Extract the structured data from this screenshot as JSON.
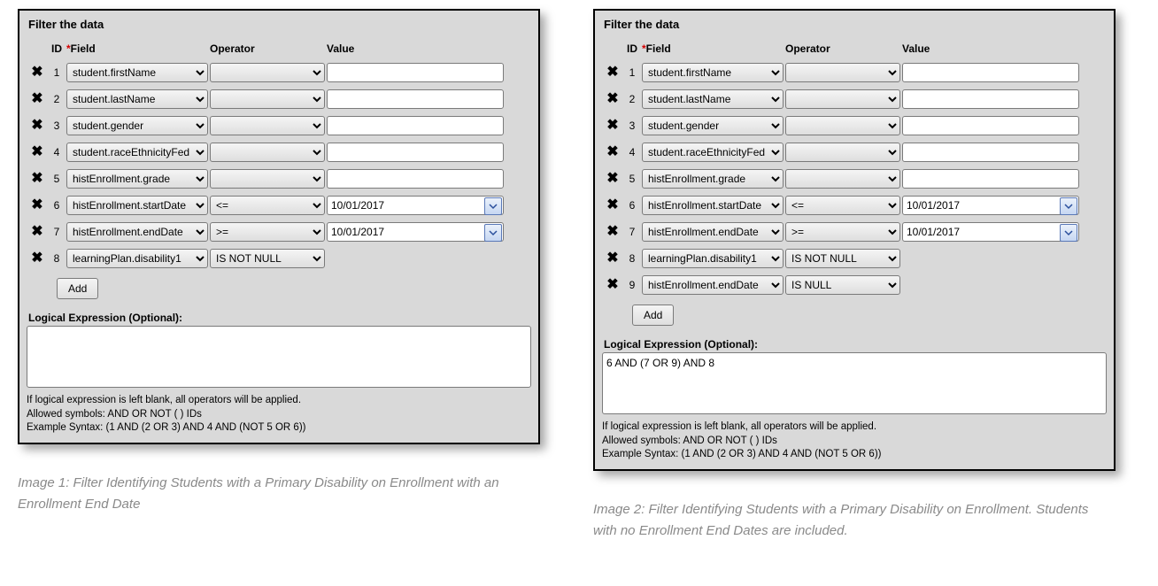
{
  "shared": {
    "panelTitle": "Filter the data",
    "headers": {
      "id": "ID",
      "fieldAsterisk": "*",
      "field": "Field",
      "operator": "Operator",
      "value": "Value"
    },
    "addLabel": "Add",
    "lexLabel": "Logical Expression (Optional):",
    "help1": "If logical expression is left blank, all operators will be applied.",
    "help2": "Allowed symbols: AND OR NOT ( ) IDs",
    "help3": "Example Syntax: (1 AND (2 OR 3) AND 4 AND (NOT 5 OR 6))"
  },
  "panels": [
    {
      "rows": [
        {
          "id": "1",
          "field": "student.firstName",
          "op": "",
          "value": "",
          "date": false
        },
        {
          "id": "2",
          "field": "student.lastName",
          "op": "",
          "value": "",
          "date": false
        },
        {
          "id": "3",
          "field": "student.gender",
          "op": "",
          "value": "",
          "date": false
        },
        {
          "id": "4",
          "field": "student.raceEthnicityFed",
          "op": "",
          "value": "",
          "date": false
        },
        {
          "id": "5",
          "field": "histEnrollment.grade",
          "op": "",
          "value": "",
          "date": false
        },
        {
          "id": "6",
          "field": "histEnrollment.startDate",
          "op": "<=",
          "value": "10/01/2017",
          "date": true
        },
        {
          "id": "7",
          "field": "histEnrollment.endDate",
          "op": ">=",
          "value": "10/01/2017",
          "date": true
        },
        {
          "id": "8",
          "field": "learningPlan.disability1",
          "op": "IS NOT NULL",
          "novalue": true
        }
      ],
      "lex": "",
      "caption": "Image 1: Filter Identifying Students with a Primary Disability on Enrollment with an Enrollment End Date"
    },
    {
      "rows": [
        {
          "id": "1",
          "field": "student.firstName",
          "op": "",
          "value": "",
          "date": false
        },
        {
          "id": "2",
          "field": "student.lastName",
          "op": "",
          "value": "",
          "date": false
        },
        {
          "id": "3",
          "field": "student.gender",
          "op": "",
          "value": "",
          "date": false
        },
        {
          "id": "4",
          "field": "student.raceEthnicityFed",
          "op": "",
          "value": "",
          "date": false
        },
        {
          "id": "5",
          "field": "histEnrollment.grade",
          "op": "",
          "value": "",
          "date": false
        },
        {
          "id": "6",
          "field": "histEnrollment.startDate",
          "op": "<=",
          "value": "10/01/2017",
          "date": true
        },
        {
          "id": "7",
          "field": "histEnrollment.endDate",
          "op": ">=",
          "value": "10/01/2017",
          "date": true
        },
        {
          "id": "8",
          "field": "learningPlan.disability1",
          "op": "IS NOT NULL",
          "novalue": true
        },
        {
          "id": "9",
          "field": "histEnrollment.endDate",
          "op": "IS NULL",
          "novalue": true
        }
      ],
      "lex": "6 AND (7 OR 9) AND 8",
      "caption": "Image 2: Filter Identifying Students with a Primary Disability on Enrollment. Students with no Enrollment End Dates are included."
    }
  ]
}
